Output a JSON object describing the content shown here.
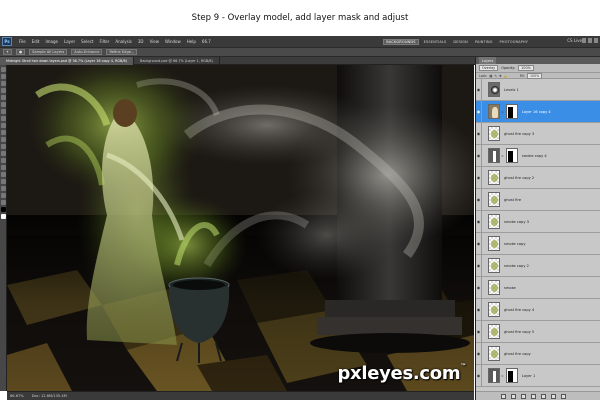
{
  "caption": "Step 9 - Overlay model, add layer mask and adjust",
  "menu": {
    "logo": "Ps",
    "items": [
      "File",
      "Edit",
      "Image",
      "Layer",
      "Select",
      "Filter",
      "Analysis",
      "3D",
      "View",
      "Window",
      "Help"
    ],
    "zoom": "66.7",
    "workspaces": [
      "BACKGROUNDS",
      "ESSENTIALS",
      "DESIGN",
      "PAINTING",
      "PHOTOGRAPHY"
    ],
    "cs_live": "CS Live"
  },
  "options": {
    "sample": "Sample All Layers",
    "auto_enhance": "Auto-Enhance",
    "refine": "Refine Edge..."
  },
  "tabs": [
    "Midnight Stroll hair down layers.psd @ 36.7% (Layer 16 copy 4, RGB/8)",
    "Background.psd @ 66.7% (Layer 1, RGB/8)"
  ],
  "status": {
    "zoom": "66.67%",
    "doc": "Doc: 12.6M/135.4M"
  },
  "layers_panel": {
    "tab": "Layers",
    "blend_mode": "Overlay",
    "opacity_label": "Opacity:",
    "opacity_value": "100%",
    "fill_label": "Fill:",
    "fill_value": "100%",
    "lock_label": "Lock:",
    "layers": [
      {
        "name": "Levels 1",
        "thumb": "adj",
        "selected": false,
        "mask": false,
        "chain": false
      },
      {
        "name": "Layer 16 copy 4",
        "thumb": "photo",
        "selected": true,
        "mask": true,
        "chain": true
      },
      {
        "name": "ghost fire copy 3",
        "thumb": "fire",
        "selected": false,
        "mask": false,
        "chain": false
      },
      {
        "name": "smoke copy 4",
        "thumb": "dark",
        "selected": false,
        "mask": true,
        "chain": true
      },
      {
        "name": "ghost fire copy 2",
        "thumb": "fire",
        "selected": false,
        "mask": false,
        "chain": false
      },
      {
        "name": "ghost fire",
        "thumb": "fire",
        "selected": false,
        "mask": false,
        "chain": false
      },
      {
        "name": "smoke copy 3",
        "thumb": "fire",
        "selected": false,
        "mask": false,
        "chain": false
      },
      {
        "name": "smoke copy",
        "thumb": "fire",
        "selected": false,
        "mask": false,
        "chain": false
      },
      {
        "name": "smoke copy 2",
        "thumb": "fire",
        "selected": false,
        "mask": false,
        "chain": false
      },
      {
        "name": "smoke",
        "thumb": "fire",
        "selected": false,
        "mask": false,
        "chain": false
      },
      {
        "name": "ghost fire copy 4",
        "thumb": "fire",
        "selected": false,
        "mask": false,
        "chain": false
      },
      {
        "name": "ghost fire copy 5",
        "thumb": "fire",
        "selected": false,
        "mask": false,
        "chain": false
      },
      {
        "name": "ghost fire copy",
        "thumb": "fire",
        "selected": false,
        "mask": false,
        "chain": false
      },
      {
        "name": "Layer 1",
        "thumb": "dark",
        "selected": false,
        "mask": true,
        "chain": true
      }
    ]
  },
  "watermark": "pxleyes.com",
  "colors": {
    "selection": "#3a8ee6",
    "chrome_dark": "#3a3a3a",
    "panel_bg": "#c8c8c8"
  }
}
